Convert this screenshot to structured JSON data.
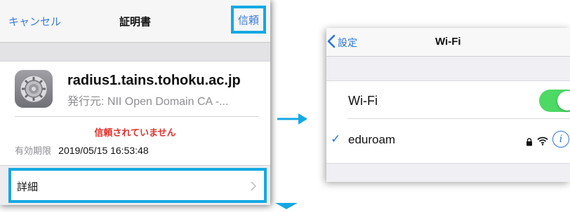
{
  "certificate_screen": {
    "nav": {
      "cancel_label": "キャンセル",
      "title": "証明書",
      "trust_label": "信頼"
    },
    "certificate": {
      "name": "radius1.tains.tohoku.ac.jp",
      "issuer": "発行元: NII Open Domain CA -...",
      "status": "信頼されていません",
      "expiry_label": "有効期限",
      "expiry_value": "2019/05/15 16:53:48"
    },
    "details_label": "詳細"
  },
  "wifi_screen": {
    "nav": {
      "back_label": "設定",
      "title": "Wi-Fi"
    },
    "wifi_toggle": {
      "label": "Wi-Fi",
      "on": true
    },
    "network": {
      "checkmark": "✓",
      "name": "eduroam",
      "secured": true,
      "info_symbol": "i"
    }
  },
  "colors": {
    "highlight": "#15a8e3",
    "ios_blue": "#2a74d5",
    "warning_red": "#e0302a",
    "toggle_green": "#4cd964"
  },
  "icons": [
    "settings-gear-icon",
    "chevron-right-icon",
    "chevron-left-icon",
    "lock-icon",
    "wifi-signal-icon",
    "info-icon",
    "arrow-right-icon",
    "arrow-down-icon"
  ]
}
